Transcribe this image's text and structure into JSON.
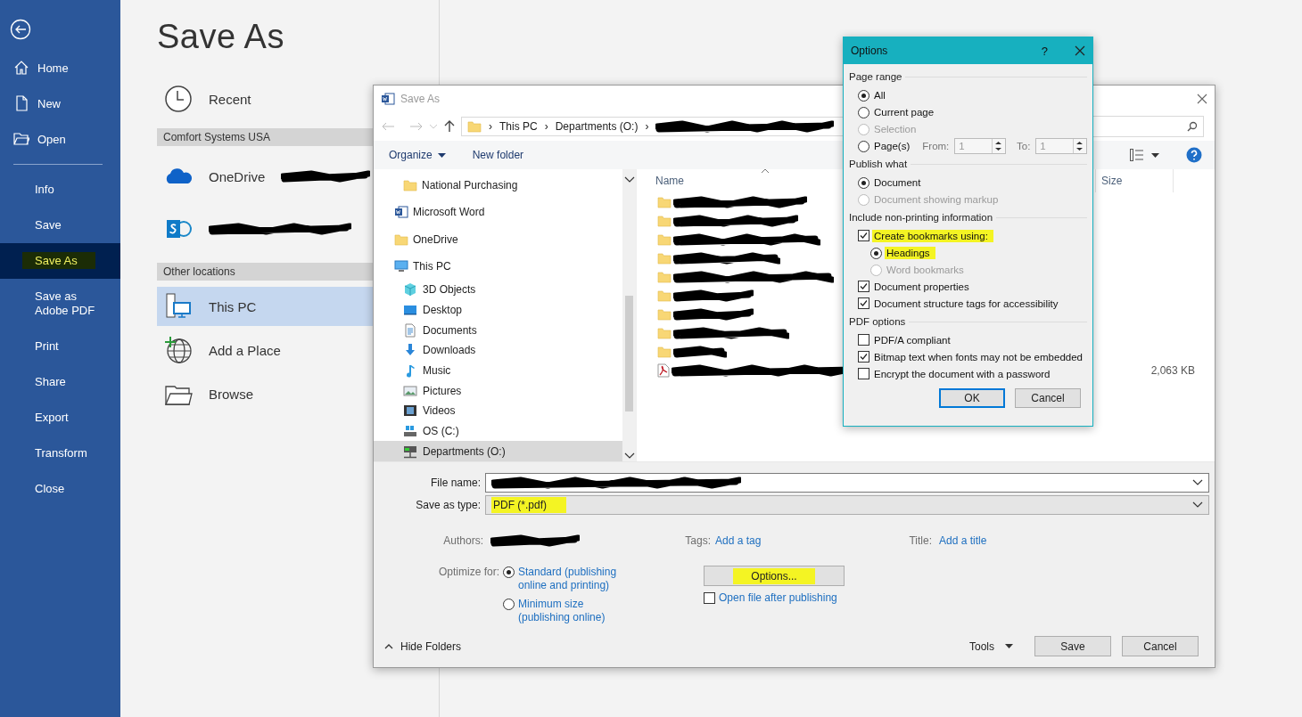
{
  "sidebar": {
    "top_items": [
      {
        "kind": "home",
        "label": "Home"
      },
      {
        "kind": "new",
        "label": "New"
      },
      {
        "kind": "open",
        "label": "Open"
      }
    ],
    "items": [
      {
        "label": "Info",
        "selected": false,
        "highlighted": false
      },
      {
        "label": "Save",
        "selected": false,
        "highlighted": false
      },
      {
        "label": "Save As",
        "selected": true,
        "highlighted": true
      },
      {
        "label": "Save as Adobe PDF",
        "selected": false,
        "highlighted": false
      },
      {
        "label": "Print",
        "selected": false,
        "highlighted": false
      },
      {
        "label": "Share",
        "selected": false,
        "highlighted": false
      },
      {
        "label": "Export",
        "selected": false,
        "highlighted": false
      },
      {
        "label": "Transform",
        "selected": false,
        "highlighted": false
      },
      {
        "label": "Close",
        "selected": false,
        "highlighted": false
      }
    ]
  },
  "page_title": "Save As",
  "places": [
    {
      "kind": "recent",
      "label": "Recent",
      "selected": false
    },
    {
      "kind": "header",
      "label": "Comfort Systems USA"
    },
    {
      "kind": "onedrive",
      "label": "OneDrive",
      "selected": false,
      "redacted": true
    },
    {
      "kind": "sharepoint",
      "selected": false,
      "redacted": true
    },
    {
      "kind": "header",
      "label": "Other locations"
    },
    {
      "kind": "pc",
      "label": "This PC",
      "selected": true
    },
    {
      "kind": "add",
      "label": "Add a Place",
      "selected": false
    },
    {
      "kind": "browse",
      "label": "Browse",
      "selected": false
    }
  ],
  "save_dialog": {
    "title": "Save As",
    "breadcrumbs": [
      {
        "separator": "›",
        "label": "This PC"
      },
      {
        "separator": "›",
        "label": "Departments (O:)"
      },
      {
        "separator": "›",
        "redacted": true
      }
    ],
    "toolbar": {
      "organize": "Organize",
      "new_folder": "New folder"
    },
    "nav_tree": [
      {
        "label": "National Purchasing",
        "kind": "folder",
        "selected": false
      },
      {
        "label": "Microsoft Word",
        "kind": "word",
        "selected": false
      },
      {
        "label": "OneDrive",
        "kind": "folder",
        "selected": false
      },
      {
        "label": "This PC",
        "kind": "pc",
        "selected": false,
        "children": [
          {
            "label": "3D Objects",
            "kind": "cube",
            "selected": false
          },
          {
            "label": "Desktop",
            "kind": "desktop",
            "selected": false
          },
          {
            "label": "Documents",
            "kind": "docs",
            "selected": false
          },
          {
            "label": "Downloads",
            "kind": "download",
            "selected": false
          },
          {
            "label": "Music",
            "kind": "music",
            "selected": false
          },
          {
            "label": "Pictures",
            "kind": "pictures",
            "selected": false
          },
          {
            "label": "Videos",
            "kind": "videos",
            "selected": false
          },
          {
            "label": "OS (C:)",
            "kind": "drive",
            "selected": false
          },
          {
            "label": "Departments (O:)",
            "kind": "netdrive",
            "selected": true
          }
        ]
      }
    ],
    "columns": [
      "Name",
      "Size"
    ],
    "files": [
      {
        "kind": "folder"
      },
      {
        "kind": "folder"
      },
      {
        "kind": "folder"
      },
      {
        "kind": "folder"
      },
      {
        "kind": "folder"
      },
      {
        "kind": "folder"
      },
      {
        "kind": "folder"
      },
      {
        "kind": "folder"
      },
      {
        "kind": "folder"
      },
      {
        "kind": "pdf",
        "size": "2,063 KB"
      }
    ],
    "file_name": {
      "label": "File name:",
      "redacted": true
    },
    "save_as_type": {
      "label": "Save as type:",
      "value": "PDF (*.pdf)",
      "highlighted": true
    },
    "authors": {
      "label": "Authors:",
      "redacted": true
    },
    "tags": {
      "label": "Tags:",
      "value": "Add a tag"
    },
    "title_field": {
      "label": "Title:",
      "value": "Add a title"
    },
    "optimize": {
      "label": "Optimize for:",
      "options": [
        {
          "label": "Standard (publishing online and printing)",
          "selected": true
        },
        {
          "label": "Minimum size (publishing online)",
          "selected": false
        }
      ]
    },
    "options_button": {
      "label": "Options...",
      "highlighted": true
    },
    "open_after": {
      "label": "Open file after publishing",
      "checked": false
    },
    "hide_folders": "Hide Folders",
    "tools": "Tools",
    "buttons": [
      "Save",
      "Cancel"
    ]
  },
  "options_dialog": {
    "title": "Options",
    "help": "?",
    "sections": [
      {
        "title": "Page range",
        "items": [
          {
            "kind": "radio",
            "label": "All",
            "selected": true,
            "disabled": false,
            "highlighted": false
          },
          {
            "kind": "radio",
            "label": "Current page",
            "selected": false,
            "disabled": false,
            "highlighted": false
          },
          {
            "kind": "radio",
            "label": "Selection",
            "selected": false,
            "disabled": true,
            "highlighted": false
          },
          {
            "kind": "pages",
            "label": "Page(s)",
            "selected": false,
            "disabled": false,
            "highlighted": false,
            "from_label": "From:",
            "from": "1",
            "to_label": "To:",
            "to": "1"
          }
        ]
      },
      {
        "title": "Publish what",
        "items": [
          {
            "kind": "radio",
            "label": "Document",
            "selected": true,
            "disabled": false,
            "highlighted": false
          },
          {
            "kind": "radio",
            "label": "Document showing markup",
            "selected": false,
            "disabled": true,
            "highlighted": false
          }
        ]
      },
      {
        "title": "Include non-printing information",
        "items": [
          {
            "kind": "checkbox",
            "label": "Create bookmarks using:",
            "checked": true,
            "highlighted": true,
            "children": [
              {
                "kind": "radio",
                "label": "Headings",
                "selected": true,
                "disabled": false,
                "highlighted": true
              },
              {
                "kind": "radio",
                "label": "Word bookmarks",
                "selected": false,
                "disabled": true,
                "highlighted": false
              }
            ]
          },
          {
            "kind": "checkbox",
            "label": "Document properties",
            "checked": true,
            "highlighted": false
          },
          {
            "kind": "checkbox",
            "label": "Document structure tags for accessibility",
            "checked": true,
            "highlighted": false
          }
        ]
      },
      {
        "title": "PDF options",
        "items": [
          {
            "kind": "checkbox",
            "label": "PDF/A compliant",
            "checked": false,
            "highlighted": false
          },
          {
            "kind": "checkbox",
            "label": "Bitmap text when fonts may not be embedded",
            "checked": true,
            "highlighted": false
          },
          {
            "kind": "checkbox",
            "label": "Encrypt the document with a password",
            "checked": false,
            "highlighted": false
          }
        ]
      }
    ],
    "buttons": [
      {
        "label": "OK",
        "default": true
      },
      {
        "label": "Cancel",
        "default": false
      }
    ]
  }
}
